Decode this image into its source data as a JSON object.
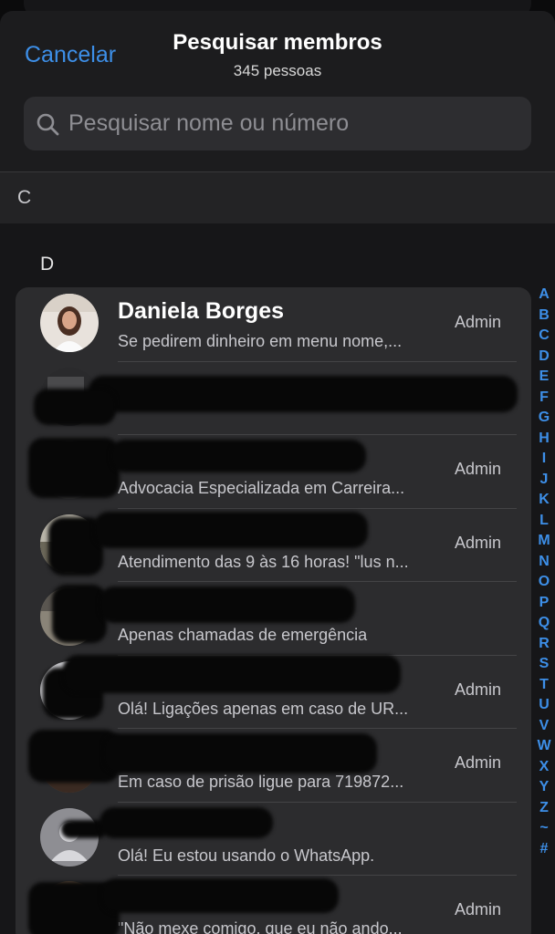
{
  "header": {
    "cancel_label": "Cancelar",
    "title": "Pesquisar membros",
    "subtitle": "345 pessoas"
  },
  "search": {
    "placeholder": "Pesquisar nome ou número",
    "icon": "search-icon"
  },
  "sections": {
    "c": "C",
    "d": "D"
  },
  "members": [
    {
      "name": "Daniela Borges",
      "status": "Se pedirem dinheiro em menu nome,...",
      "role": "Admin"
    },
    {
      "name": "",
      "status": "",
      "role": ""
    },
    {
      "name": "",
      "status": "Advocacia Especializada em Carreira...",
      "role": "Admin"
    },
    {
      "name": "",
      "status": "Atendimento das 9 às 16 horas! \"lus n...",
      "role": "Admin"
    },
    {
      "name": "",
      "status": "Apenas chamadas de emergência",
      "role": ""
    },
    {
      "name": "",
      "status": "Olá! Ligações apenas em caso de UR...",
      "role": "Admin"
    },
    {
      "name": "",
      "status": "Em caso de prisão ligue para 719872...",
      "role": "Admin"
    },
    {
      "name": "",
      "status": "Olá! Eu estou usando o WhatsApp.",
      "role": ""
    },
    {
      "name": "",
      "status": "\"Não mexe comigo, que eu não ando...",
      "role": "Admin"
    }
  ],
  "index_letters": [
    "A",
    "B",
    "C",
    "D",
    "E",
    "F",
    "G",
    "H",
    "I",
    "J",
    "K",
    "L",
    "M",
    "N",
    "O",
    "P",
    "Q",
    "R",
    "S",
    "T",
    "U",
    "V",
    "W",
    "X",
    "Y",
    "Z",
    "~",
    "#"
  ],
  "colors": {
    "accent": "#3d8fe8",
    "background": "#1c1c1e",
    "row_background": "#2c2c2e"
  }
}
